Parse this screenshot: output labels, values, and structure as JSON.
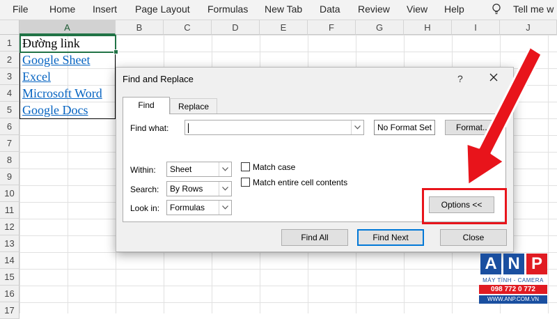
{
  "menu": [
    "File",
    "Home",
    "Insert",
    "Page Layout",
    "Formulas",
    "New Tab",
    "Data",
    "Review",
    "View",
    "Help"
  ],
  "tell_me": "Tell me w",
  "columns": [
    "A",
    "B",
    "C",
    "D",
    "E",
    "F",
    "G",
    "H",
    "I",
    "J"
  ],
  "rows": [
    "1",
    "2",
    "3",
    "4",
    "5",
    "6",
    "7",
    "8",
    "9",
    "10",
    "11",
    "12",
    "13",
    "14",
    "15",
    "16",
    "17"
  ],
  "cells": {
    "a1": "Đường link",
    "a2": "Google Sheet",
    "a3": "Excel",
    "a4": "Microsoft Word",
    "a5": "Google Docs"
  },
  "dialog": {
    "title": "Find and Replace",
    "help": "?",
    "tabs": {
      "find": "Find",
      "replace": "Replace"
    },
    "find_what_label": "Find what:",
    "find_what_value": "",
    "no_format": "No Format Set",
    "format_btn": "Format...",
    "within_label": "Within:",
    "within_value": "Sheet",
    "search_label": "Search:",
    "search_value": "By Rows",
    "lookin_label": "Look in:",
    "lookin_value": "Formulas",
    "match_case": "Match case",
    "match_entire": "Match entire cell contents",
    "options_btn": "Options <<",
    "find_all": "Find All",
    "find_next": "Find Next",
    "close": "Close"
  },
  "watermark": {
    "letters": [
      "A",
      "N",
      "P"
    ],
    "line1": "MÁY TÍNH - CAMERA",
    "line2": "098 772 0 772",
    "line3": "WWW.ANP.COM.VN"
  },
  "colors": {
    "excel_green": "#217346",
    "link_blue": "#0563c1",
    "highlight_red": "#e8141b",
    "anp_blue": "#1a4fa0",
    "anp_red": "#e01b22"
  }
}
